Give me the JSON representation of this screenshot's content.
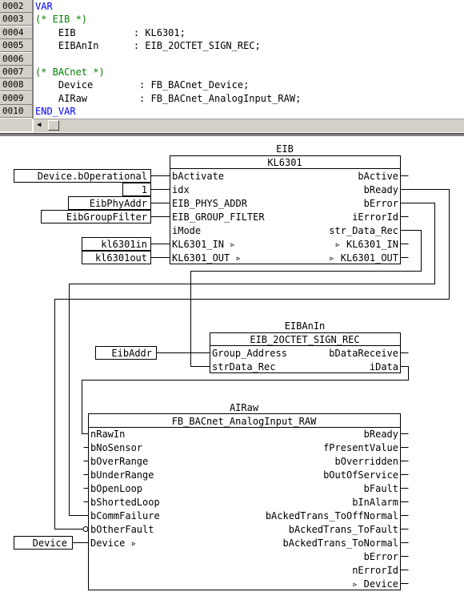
{
  "declaration": {
    "lines": [
      {
        "num": "0002",
        "parts": [
          {
            "t": "VAR",
            "c": "kw"
          }
        ]
      },
      {
        "num": "0003",
        "parts": [
          {
            "t": "(* EIB *)",
            "c": "cm"
          }
        ]
      },
      {
        "num": "0004",
        "parts": [
          {
            "t": "    EIB          : KL6301;",
            "c": ""
          }
        ]
      },
      {
        "num": "0005",
        "parts": [
          {
            "t": "    EIBAnIn      : EIB_2OCTET_SIGN_REC;",
            "c": ""
          }
        ]
      },
      {
        "num": "0006",
        "parts": []
      },
      {
        "num": "0007",
        "parts": [
          {
            "t": "(* BACnet *)",
            "c": "cm"
          }
        ]
      },
      {
        "num": "0008",
        "parts": [
          {
            "t": "    Device        : FB_BACnet_Device;",
            "c": ""
          }
        ]
      },
      {
        "num": "0009",
        "parts": [
          {
            "t": "    AIRaw         : FB_BACnet_AnalogInput_RAW;",
            "c": ""
          }
        ]
      },
      {
        "num": "0010",
        "parts": [
          {
            "t": "END_VAR",
            "c": "kw"
          }
        ]
      }
    ]
  },
  "fbd": {
    "eib": {
      "instance": "EIB",
      "type": "KL6301",
      "inputs": [
        "bActivate",
        "idx",
        "EIB_PHYS_ADDR",
        "EIB_GROUP_FILTER",
        "iMode",
        "KL6301_IN ▹",
        "KL6301_OUT ▹"
      ],
      "outputs": [
        "bActive",
        "bReady",
        "bError",
        "iErrorId",
        "str_Data_Rec",
        "▹ KL6301_IN",
        "▹ KL6301_OUT"
      ]
    },
    "eiban": {
      "instance": "EIBAnIn",
      "type": "EIB_2OCTET_SIGN_REC",
      "inputs": [
        "Group_Address",
        "strData_Rec"
      ],
      "outputs": [
        "bDataReceive",
        "iData"
      ]
    },
    "airaw": {
      "instance": "AIRaw",
      "type": "FB_BACnet_AnalogInput_RAW",
      "inputs": [
        "nRawIn",
        "bNoSensor",
        "bOverRange",
        "bUnderRange",
        "bOpenLoop",
        "bShortedLoop",
        "bCommFailure",
        "bOtherFault",
        "Device ▹"
      ],
      "outputs": [
        "bReady",
        "fPresentValue",
        "bOverridden",
        "bOutOfService",
        "bFault",
        "bInAlarm",
        "bAckedTrans_ToOffNormal",
        "bAckedTrans_ToFault",
        "bAckedTrans_ToNormal",
        "bError",
        "nErrorId",
        "▹ Device"
      ]
    },
    "variables": {
      "device_operational": "Device.bOperational",
      "idx_const": "1",
      "eib_phy_addr": "EibPhyAddr",
      "eib_group_filter": "EibGroupFilter",
      "kl_in": "kl6301in",
      "kl_out": "kl6301out",
      "eib_addr": "EibAddr",
      "device": "Device"
    }
  }
}
